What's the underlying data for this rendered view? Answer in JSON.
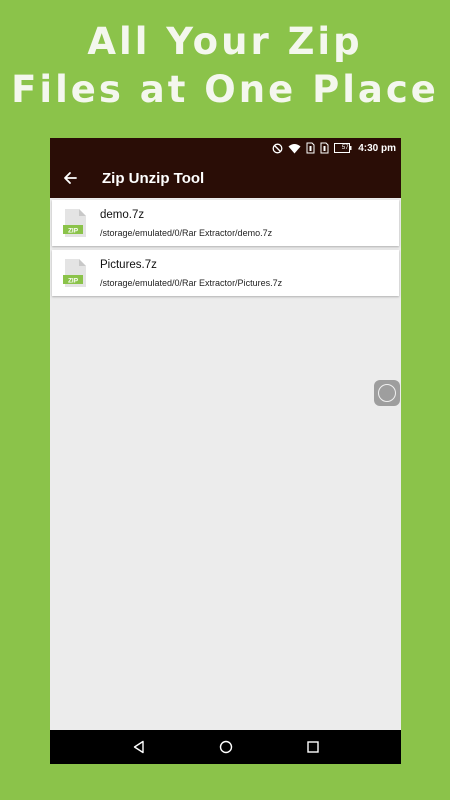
{
  "headline": {
    "line1": "All Your Zip",
    "line2": "Files at One Place"
  },
  "status_bar": {
    "time": "4:30 pm",
    "battery": "57",
    "icons": [
      "do-not-disturb-icon",
      "wifi-icon",
      "sim1-icon",
      "sim2-icon",
      "battery-icon"
    ]
  },
  "toolbar": {
    "title": "Zip Unzip Tool",
    "back_icon": "back-arrow-icon"
  },
  "files": [
    {
      "name": "demo.7z",
      "path": "/storage/emulated/0/Rar Extractor/demo.7z",
      "icon_label": "ZIP"
    },
    {
      "name": "Pictures.7z",
      "path": "/storage/emulated/0/Rar Extractor/Pictures.7z",
      "icon_label": "ZIP"
    }
  ],
  "nav_bar": {
    "buttons": [
      "back-triangle-icon",
      "home-circle-icon",
      "recents-square-icon"
    ]
  },
  "colors": {
    "background": "#8bc34a",
    "toolbar": "#2a0d06",
    "zip_icon": "#8bc34a"
  }
}
